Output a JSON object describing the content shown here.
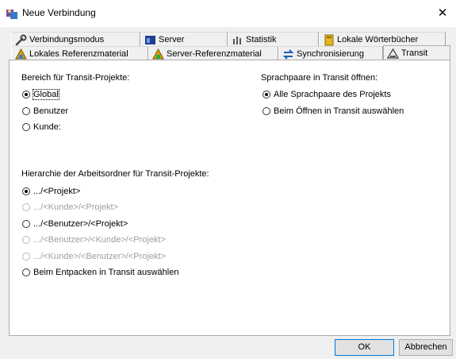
{
  "window": {
    "title": "Neue Verbindung",
    "close": "✕"
  },
  "tabs_row1": [
    {
      "label": "Verbindungsmodus",
      "icon": "wrench-icon"
    },
    {
      "label": "Server",
      "icon": "server-icon"
    },
    {
      "label": "Statistik",
      "icon": "statistics-icon"
    },
    {
      "label": "Lokale Wörterbücher",
      "icon": "dictionary-icon"
    }
  ],
  "tabs_row2": [
    {
      "label": "Lokales Referenzmaterial",
      "icon": "local-reference-icon"
    },
    {
      "label": "Server-Referenzmaterial",
      "icon": "server-reference-icon"
    },
    {
      "label": "Synchronisierung",
      "icon": "sync-arrows-icon"
    },
    {
      "label": "Transit",
      "icon": "transit-icon",
      "active": true
    }
  ],
  "bereich": {
    "heading": "Bereich für Transit-Projekte:",
    "options": [
      {
        "label": "Global",
        "checked": true
      },
      {
        "label": "Benutzer",
        "checked": false
      },
      {
        "label": "Kunde:",
        "checked": false
      }
    ]
  },
  "sprachpaare": {
    "heading": "Sprachpaare in Transit öffnen:",
    "options": [
      {
        "label": "Alle Sprachpaare des Projekts",
        "checked": true
      },
      {
        "label": "Beim Öffnen in Transit auswählen",
        "checked": false
      }
    ]
  },
  "hierarchie": {
    "heading": "Hierarchie der Arbeitsordner für Transit-Projekte:",
    "options": [
      {
        "label": ".../<Projekt>",
        "checked": true,
        "disabled": false
      },
      {
        "label": ".../<Kunde>/<Projekt>",
        "checked": false,
        "disabled": true
      },
      {
        "label": ".../<Benutzer>/<Projekt>",
        "checked": false,
        "disabled": false
      },
      {
        "label": ".../<Benutzer>/<Kunde>/<Projekt>",
        "checked": false,
        "disabled": true
      },
      {
        "label": ".../<Kunde>/<Benutzer>/<Projekt>",
        "checked": false,
        "disabled": true
      },
      {
        "label": "Beim Entpacken in Transit auswählen",
        "checked": false,
        "disabled": false
      }
    ]
  },
  "buttons": {
    "ok": "OK",
    "cancel": "Abbrechen"
  }
}
